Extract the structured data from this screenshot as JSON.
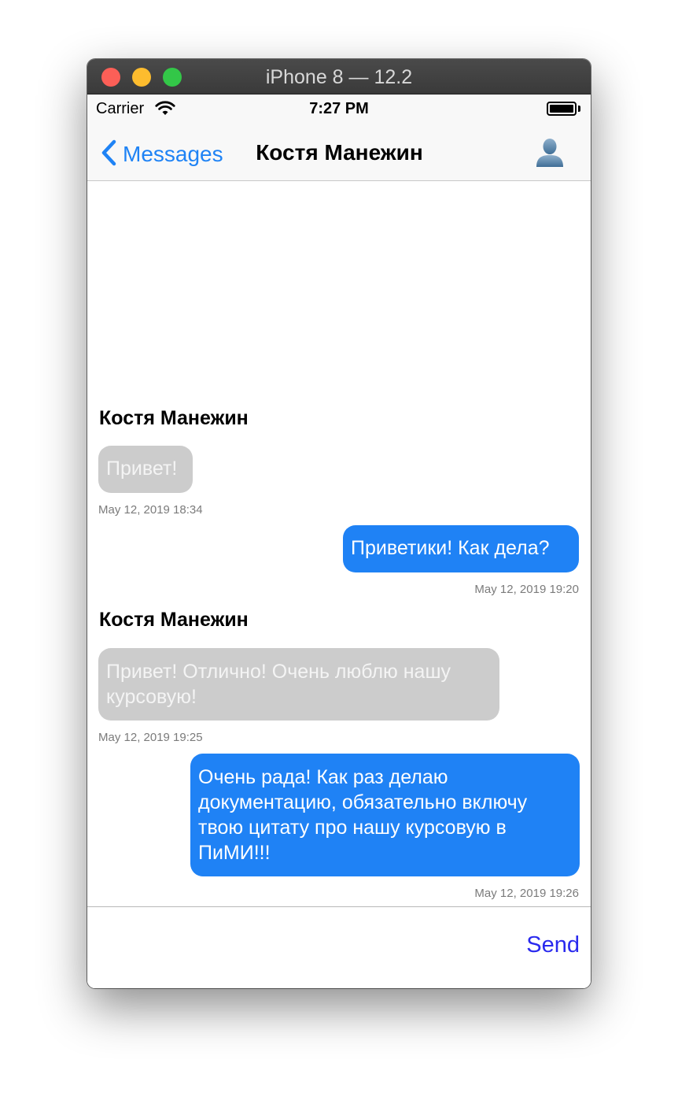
{
  "window": {
    "title": "iPhone 8 — 12.2"
  },
  "status_bar": {
    "carrier": "Carrier",
    "time": "7:27 PM"
  },
  "navbar": {
    "back_label": "Messages",
    "title": "Костя Манежин",
    "back_icon": "chevron-left-icon",
    "contact_icon": "person-icon",
    "accent_color": "#1f83f5"
  },
  "messages": [
    {
      "direction": "incoming",
      "sender": "Костя Манежин",
      "lines": [
        "Привет!"
      ],
      "timestamp": "May 12, 2019 18:34"
    },
    {
      "direction": "outgoing",
      "lines": [
        "Приветики! Как дела?"
      ],
      "timestamp": "May 12, 2019 19:20"
    },
    {
      "direction": "incoming",
      "sender": "Костя Манежин",
      "lines": [
        "Привет! Отлично! Очень люблю нашу",
        "курсовую!"
      ],
      "timestamp": "May 12, 2019 19:25"
    },
    {
      "direction": "outgoing",
      "lines": [
        "Очень рада! Как раз делаю",
        "документацию, обязательно включу",
        "твою цитату про нашу курсовую в",
        "ПиМИ!!!"
      ],
      "timestamp": "May 12, 2019 19:26"
    }
  ],
  "input": {
    "value": "",
    "send_label": "Send",
    "send_color": "#2a2aee"
  },
  "colors": {
    "incoming_bubble": "#cccccc",
    "outgoing_bubble": "#1f82f5"
  }
}
